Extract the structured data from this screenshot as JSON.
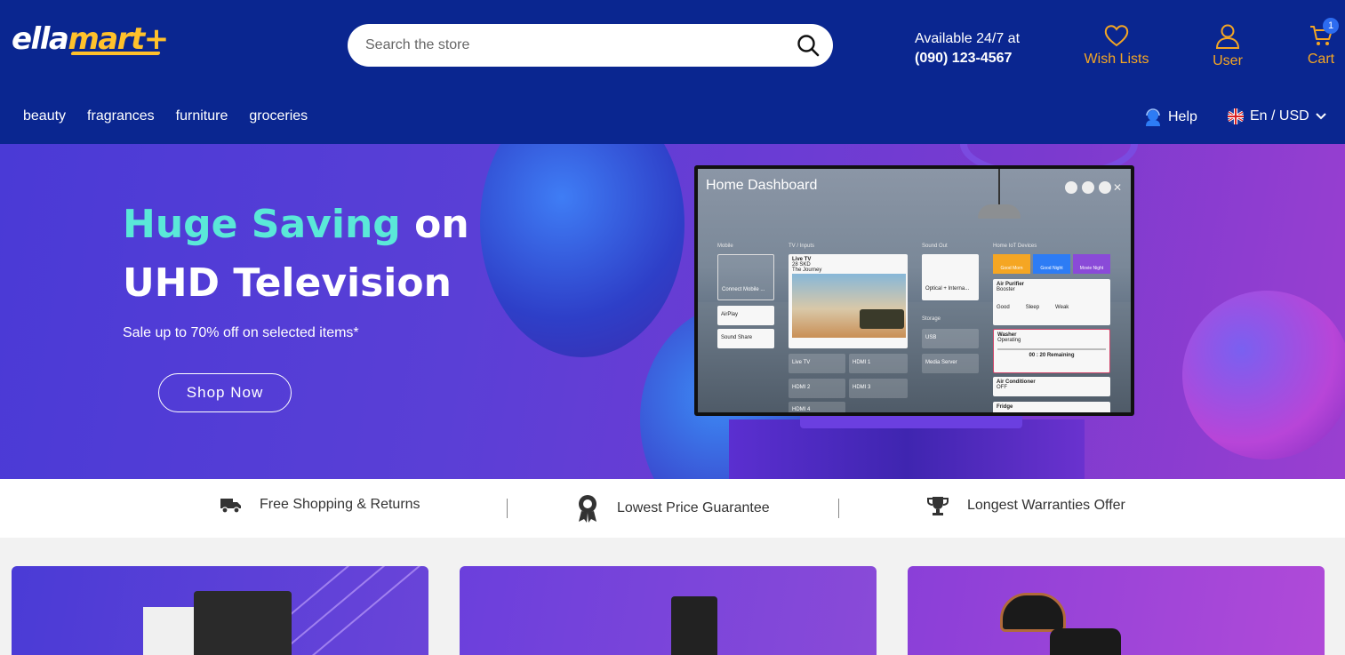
{
  "brand": {
    "logo_white": "ella",
    "logo_yellow": "mart+"
  },
  "search": {
    "placeholder": "Search the store"
  },
  "contact": {
    "line1": "Available 24/7 at",
    "phone": "(090) 123-4567"
  },
  "header_actions": {
    "wish_label": "Wish Lists",
    "user_label": "User",
    "cart_label": "Cart",
    "cart_count": "1"
  },
  "nav": [
    "beauty",
    "fragrances",
    "furniture",
    "groceries"
  ],
  "utility": {
    "help_label": "Help",
    "lang_label": "En / USD"
  },
  "hero": {
    "title_accent": "Huge Saving",
    "title_rest": " on",
    "title_line2": "UHD Television",
    "subtitle": "Sale up to 70% off on selected items*",
    "cta": "Shop Now"
  },
  "tv": {
    "title": "Home Dashboard",
    "sections": {
      "mobile": "Mobile",
      "inputs": "TV / Inputs",
      "sound": "Sound Out",
      "storage": "Storage",
      "devices": "Home IoT Devices"
    },
    "mobile_cards": [
      "Connect Mobile ...",
      "AirPlay",
      "Sound Share"
    ],
    "live_tv": {
      "title": "Live TV",
      "channel": "28 SKD",
      "show": "The Journey"
    },
    "input_tiles": [
      "Live TV",
      "HDMI 1",
      "HDMI 2",
      "HDMI 3",
      "HDMI 4"
    ],
    "sound_card": "Optical + Interna...",
    "storage_tiles": [
      "USB",
      "Media Server"
    ],
    "modes": [
      "Good Morn",
      "Good Night",
      "Movie Night"
    ],
    "devices": [
      {
        "name": "Air Purifier",
        "status": "Booster"
      },
      {
        "name": "Washer",
        "status": "Operating",
        "detail": "00 : 20 Remaining"
      },
      {
        "name": "Air Conditioner",
        "status": "OFF"
      },
      {
        "name": "Fridge",
        "status": ""
      }
    ],
    "purifier_modes": [
      "Good",
      "Sleep",
      "Weak"
    ]
  },
  "benefits": [
    "Free Shopping & Returns",
    "Lowest Price Guarantee",
    "Longest Warranties Offer"
  ],
  "colors": {
    "header_bg": "#0a2690",
    "accent_orange": "#f5a623",
    "logo_yellow": "#ffc12b",
    "hero_accent": "#5ae8d8"
  }
}
